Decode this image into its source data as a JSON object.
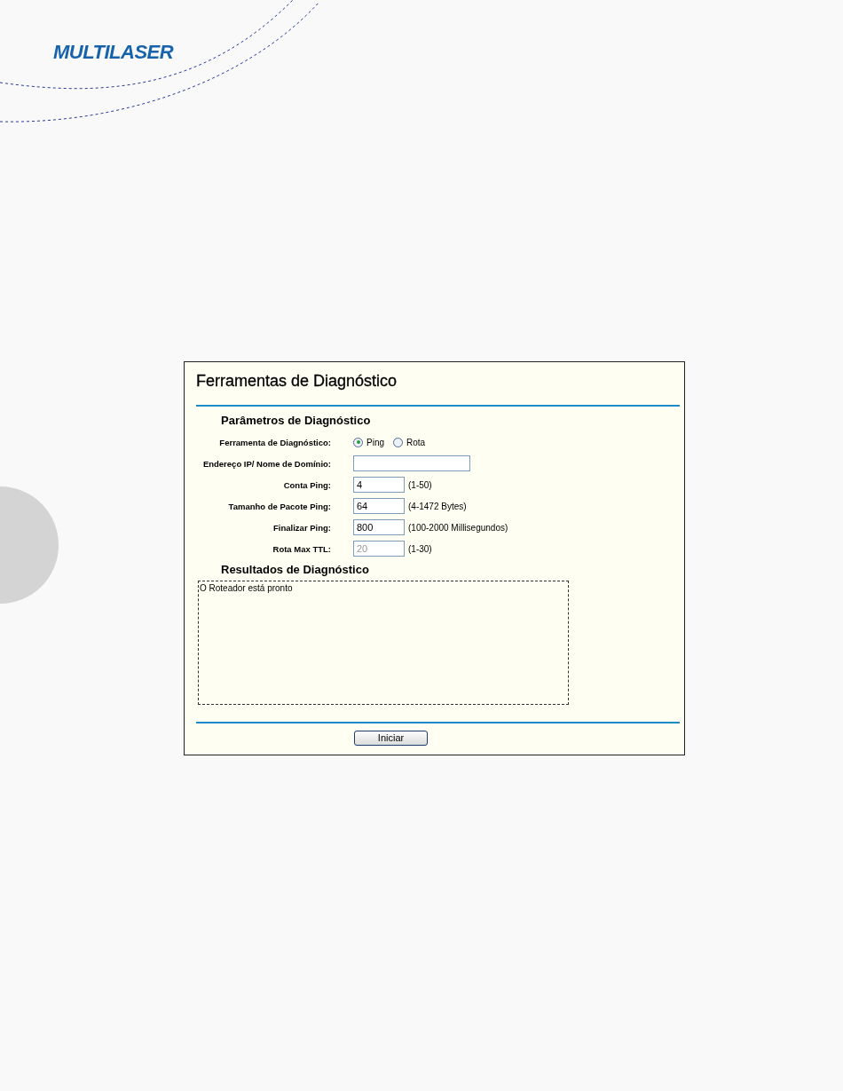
{
  "logo": {
    "text": "MULTILASER"
  },
  "panel": {
    "title": "Ferramentas de Diagnóstico",
    "parameters_heading": "Parâmetros de Diagnóstico",
    "fields": [
      {
        "kind": "radio",
        "label": "Ferramenta de Diagnóstico:",
        "options": [
          {
            "label": "Ping",
            "selected": true
          },
          {
            "label": "Rota",
            "selected": false
          }
        ]
      },
      {
        "kind": "text",
        "label": "Endereço IP/ Nome de Domínio:",
        "wide": true,
        "disabled": false
      },
      {
        "kind": "text",
        "label": "Conta Ping:",
        "value": "4",
        "hint": "(1-50)",
        "disabled": false
      },
      {
        "kind": "text",
        "label": "Tamanho de Pacote Ping:",
        "value": "64",
        "hint": "(4-1472 Bytes)",
        "disabled": false
      },
      {
        "kind": "text",
        "label": "Finalizar Ping:",
        "value": "800",
        "hint": "(100-2000 Millisegundos)",
        "disabled": false
      },
      {
        "kind": "text",
        "label": "Rota Max TTL:",
        "value": "20",
        "hint": "(1-30)",
        "disabled": true
      }
    ],
    "results_heading": "Resultados de Diagnóstico",
    "results_text": "O Roteador está pronto",
    "button": "Iniciar"
  }
}
